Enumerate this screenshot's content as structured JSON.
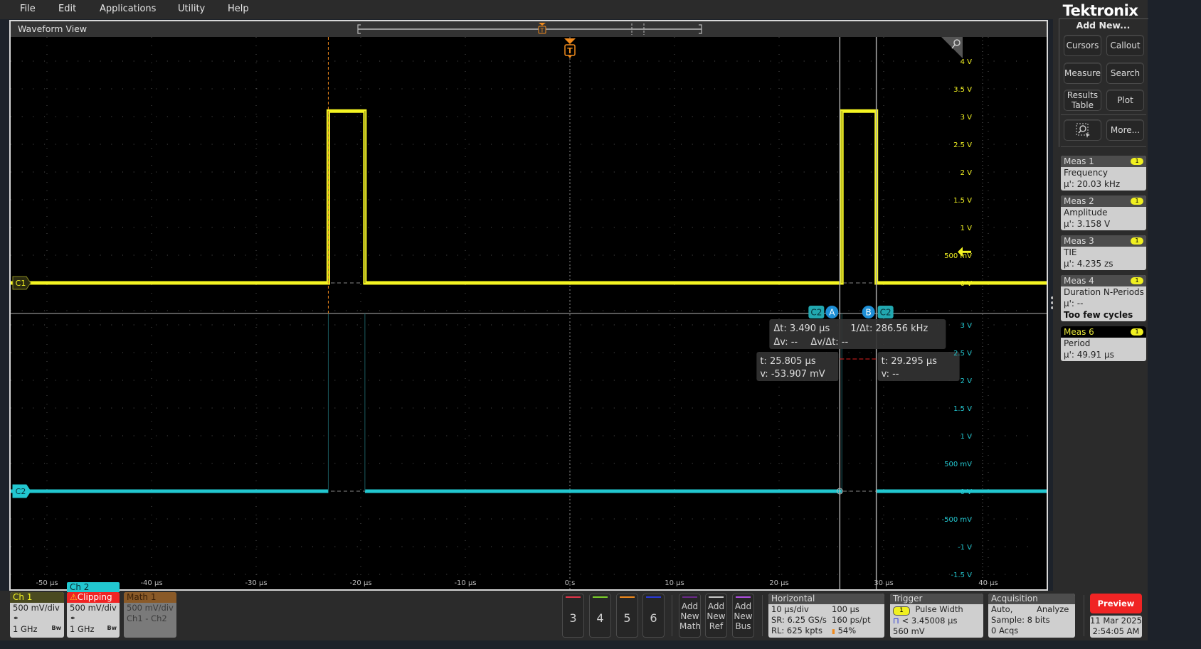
{
  "menu": [
    "File",
    "Edit",
    "Applications",
    "Utility",
    "Help"
  ],
  "waveform_view": {
    "title": "Waveform View",
    "channel_markers": {
      "ch1": "C1",
      "ch2": "C2"
    },
    "trigger_marker": "T",
    "ch1_axis": [
      "4 V",
      "3.5 V",
      "3 V",
      "2.5 V",
      "2 V",
      "1.5 V",
      "1 V",
      "500 mV",
      "0 V"
    ],
    "ch2_axis": [
      "3 V",
      "2.5 V",
      "2 V",
      "1.5 V",
      "1 V",
      "500 mV",
      "0 V",
      "-500 mV",
      "-1 V",
      "-1.5 V"
    ],
    "time_axis": [
      "-50 µs",
      "-40 µs",
      "-30 µs",
      "-20 µs",
      "-10 µs",
      "0 s",
      "10 µs",
      "20 µs",
      "30 µs",
      "40 µs"
    ],
    "colors": {
      "ch1": "#f5f522",
      "ch2": "#22c7d0",
      "trigger": "#f08a1c",
      "cursor_label": "#1e8fd6"
    },
    "ch1_waveform": {
      "low_v": 0,
      "high_v": 3.1,
      "pulses_us": [
        [
          -23.1,
          -19.6
        ],
        [
          26.0,
          29.3
        ]
      ]
    },
    "ch2_waveform": {
      "level_v": 0
    },
    "cursors": {
      "a_label": "A",
      "b_label": "B",
      "src_a": "C2",
      "src_b": "C2",
      "a_time_us": 25.805,
      "b_time_us": 29.295,
      "delta": {
        "dt": "Δt: 3.490 µs",
        "inv_dt": "1/Δt: 286.56 kHz",
        "dv": "Δv: --",
        "dvdt": "Δv/Δt: --"
      },
      "a_readout": {
        "t": "t: 25.805 µs",
        "v": "v: -53.907 mV"
      },
      "b_readout": {
        "t": "t: 29.295 µs",
        "v": "v: --"
      }
    }
  },
  "right_panel": {
    "logo": "Tektronix",
    "add_new": "Add New...",
    "buttons": [
      "Cursors",
      "Callout",
      "Measure",
      "Search",
      "Results Table",
      "Plot",
      "More..."
    ],
    "measurements": [
      {
        "name": "Meas 1",
        "badge": "1",
        "type": "Frequency",
        "value": "µ': 20.03 kHz"
      },
      {
        "name": "Meas 2",
        "badge": "1",
        "type": "Amplitude",
        "value": "µ': 3.158 V"
      },
      {
        "name": "Meas 3",
        "badge": "1",
        "type": "TIE",
        "value": "µ': 4.235 zs"
      },
      {
        "name": "Meas 4",
        "badge": "1",
        "type": "Duration N-Periods",
        "value": "µ': --",
        "note": "Too few cycles"
      },
      {
        "name": "Meas 6",
        "badge": "1",
        "type": "Period",
        "value": "µ': 49.91 µs",
        "active": true
      }
    ]
  },
  "bottom_bar": {
    "ch1": {
      "title": "Ch 1",
      "scale": "500 mV/div",
      "bw": "1 GHz",
      "bw_icon": "Bw"
    },
    "ch2": {
      "title": "Ch 2",
      "warning": "Clipping",
      "scale": "500 mV/div",
      "bw": "1 GHz",
      "bw_icon": "Bw"
    },
    "math1": {
      "title": "Math 1",
      "scale": "500 mV/div",
      "expr": "Ch1 - Ch2"
    },
    "channel_buttons": [
      {
        "label": "3",
        "color": "#e0364a"
      },
      {
        "label": "4",
        "color": "#7cd02a"
      },
      {
        "label": "5",
        "color": "#f08a1c"
      },
      {
        "label": "6",
        "color": "#2a3ad8"
      }
    ],
    "add_buttons": [
      {
        "label": "Add New Math",
        "color": "#6a2a8a"
      },
      {
        "label": "Add New Ref",
        "color": "#c8c8c8"
      },
      {
        "label": "Add New Bus",
        "color": "#b050e0"
      }
    ],
    "horizontal": {
      "title": "Horizontal",
      "scale": "10 µs/div",
      "duration": "100 µs",
      "sr": "SR: 6.25 GS/s",
      "res": "160 ps/pt",
      "rl": "RL: 625 kpts",
      "pos": "54%"
    },
    "trigger": {
      "title": "Trigger",
      "source": "1",
      "type": "Pulse Width",
      "cond": "< 3.45008 µs",
      "level": "560 mV"
    },
    "acquisition": {
      "title": "Acquisition",
      "mode": "Auto,",
      "analyze": "Analyze",
      "sample": "Sample: 8 bits",
      "acqs": "0 Acqs"
    },
    "preview": "Preview",
    "date": "11 Mar 2025",
    "time": "2:54:05 AM"
  }
}
